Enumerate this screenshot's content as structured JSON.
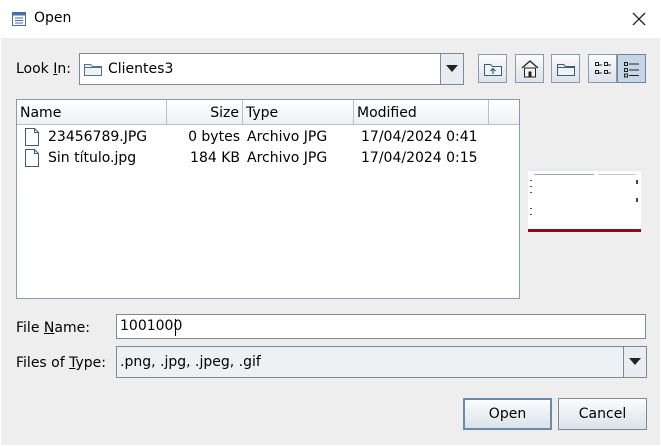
{
  "window": {
    "title": "Open",
    "title_icon": "app-window-icon",
    "close_icon": "close-icon"
  },
  "look_in": {
    "label_prefix": "Look ",
    "label_mnemonic": "I",
    "label_suffix": "n:",
    "value": "Clientes3",
    "folder_icon": "folder-icon"
  },
  "toolbar": {
    "buttons": [
      "up-one-level-icon",
      "home-icon",
      "new-folder-icon",
      "list-view-icon",
      "details-view-icon"
    ]
  },
  "file_list": {
    "columns": [
      "Name",
      "Size",
      "Type",
      "Modified"
    ],
    "rows": [
      {
        "name": "23456789.JPG",
        "size": "0 bytes",
        "type": "Archivo JPG",
        "modified": "17/04/2024 0:41"
      },
      {
        "name": "Sin título.jpg",
        "size": "184 KB",
        "type": "Archivo JPG",
        "modified": "17/04/2024 0:15"
      }
    ]
  },
  "file_name": {
    "label_prefix": "File ",
    "label_mnemonic": "N",
    "label_suffix": "ame:",
    "value": "1001000"
  },
  "files_of_type": {
    "label_prefix": "Files of ",
    "label_mnemonic": "T",
    "label_suffix": "ype:",
    "value": ".png, .jpg, .jpeg, .gif"
  },
  "actions": {
    "open_label": "Open",
    "cancel_label": "Cancel"
  },
  "colors": {
    "dialog_background": "#eeeeee",
    "border": "#7a8a99",
    "preview_accent": "#8a0f12"
  }
}
